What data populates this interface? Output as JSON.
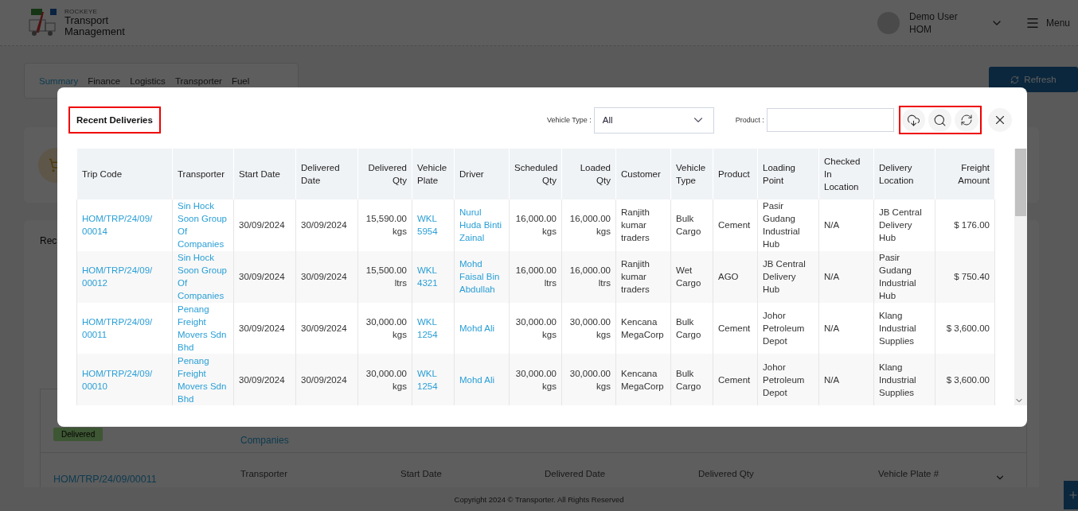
{
  "header": {
    "brand_small": "ROCKEYE",
    "brand_line_1": "Transport",
    "brand_line_2": "Management",
    "user_name": "Demo User",
    "user_role": "HOM",
    "menu_label": "Menu"
  },
  "tabs": [
    {
      "label": "Summary",
      "selected": true
    },
    {
      "label": "Finance",
      "selected": false
    },
    {
      "label": "Logistics",
      "selected": false
    },
    {
      "label": "Transporter",
      "selected": false
    },
    {
      "label": "Fuel",
      "selected": false
    }
  ],
  "refresh_button": "Refresh",
  "recent_section": {
    "title": "Rec",
    "status_badge": "Delivered",
    "transporter_tail": "Companies",
    "trip_code": "HOM/TRP/24/09/00011",
    "detail_labels": [
      "Transporter",
      "Start Date",
      "Delivered Date",
      "Delivered Qty",
      "Vehicle Plate #"
    ]
  },
  "footer": "Copyright 2024 © Transporter. All Rights Reserved",
  "modal": {
    "title": "Recent Deliveries",
    "vehicle_type_label": "Vehicle Type :",
    "vehicle_type_value": "All",
    "product_label": "Product :",
    "table": {
      "columns": [
        {
          "label": "Trip Code",
          "kind": "link"
        },
        {
          "label": "Transporter",
          "kind": "link"
        },
        {
          "label": "Start Date",
          "kind": "text"
        },
        {
          "label": "Delivered Date",
          "kind": "text"
        },
        {
          "label": "Delivered Qty",
          "kind": "number"
        },
        {
          "label": "Vehicle Plate",
          "kind": "link"
        },
        {
          "label": "Driver",
          "kind": "link"
        },
        {
          "label": "Scheduled Qty",
          "kind": "number"
        },
        {
          "label": "Loaded Qty",
          "kind": "number"
        },
        {
          "label": "Customer",
          "kind": "text"
        },
        {
          "label": "Vehicle Type",
          "kind": "text"
        },
        {
          "label": "Product",
          "kind": "text"
        },
        {
          "label": "Loading Point",
          "kind": "text"
        },
        {
          "label": "Checked In Location",
          "kind": "text"
        },
        {
          "label": "Delivery Location",
          "kind": "text"
        },
        {
          "label": "Freight Amount",
          "kind": "number"
        }
      ],
      "rows": [
        [
          "HOM/TRP/24/09/00014",
          "Sin Hock Soon Group Of Companies",
          "30/09/2024",
          "30/09/2024",
          "15,590.00 kgs",
          "WKL 5954",
          "Nurul Huda Binti Zainal",
          "16,000.00 kgs",
          "16,000.00 kgs",
          "Ranjith kumar traders",
          "Bulk Cargo",
          "Cement",
          "Pasir Gudang Industrial Hub",
          "N/A",
          "JB Central Delivery Hub",
          "$ 176.00"
        ],
        [
          "HOM/TRP/24/09/00012",
          "Sin Hock Soon Group Of Companies",
          "30/09/2024",
          "30/09/2024",
          "15,500.00 ltrs",
          "WKL 4321",
          "Mohd Faisal Bin Abdullah",
          "16,000.00 ltrs",
          "16,000.00 ltrs",
          "Ranjith kumar traders",
          "Wet Cargo",
          "AGO",
          "JB Central Delivery Hub",
          "N/A",
          "Pasir Gudang Industrial Hub",
          "$ 750.40"
        ],
        [
          "HOM/TRP/24/09/00011",
          "Penang Freight Movers Sdn Bhd",
          "30/09/2024",
          "30/09/2024",
          "30,000.00 kgs",
          "WKL 1254",
          "Mohd Ali",
          "30,000.00 kgs",
          "30,000.00 kgs",
          "Kencana MegaCorp",
          "Bulk Cargo",
          "Cement",
          "Johor Petroleum Depot",
          "N/A",
          "Klang Industrial Supplies",
          "$ 3,600.00"
        ],
        [
          "HOM/TRP/24/09/00010",
          "Penang Freight Movers Sdn Bhd",
          "30/09/2024",
          "30/09/2024",
          "30,000.00 kgs",
          "WKL 1254",
          "Mohd Ali",
          "30,000.00 kgs",
          "30,000.00 kgs",
          "Kencana MegaCorp",
          "Bulk Cargo",
          "Cement",
          "Johor Petroleum Depot",
          "N/A",
          "Klang Industrial Supplies",
          "$ 3,600.00"
        ]
      ]
    }
  }
}
